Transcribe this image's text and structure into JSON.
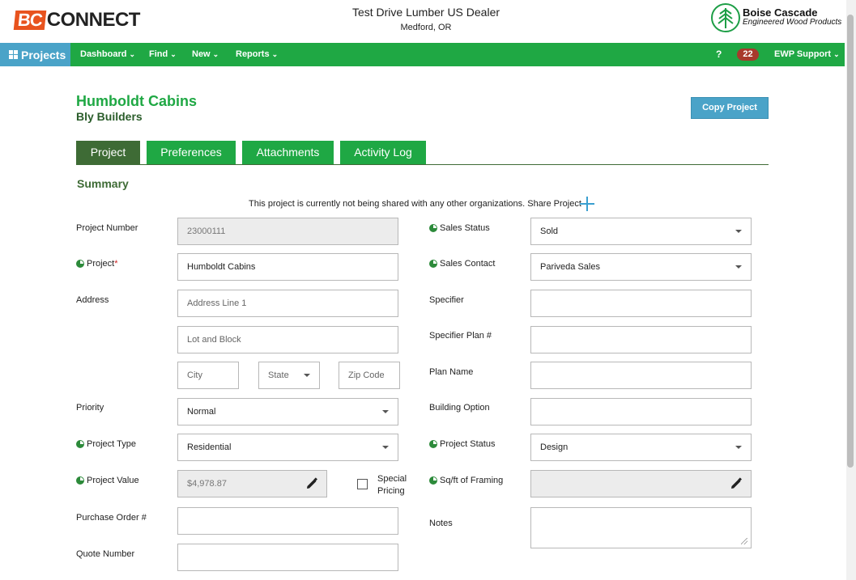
{
  "header": {
    "logo_bc": "BC",
    "logo_connect": "CONNECT",
    "dealer": "Test Drive Lumber US Dealer",
    "city": "Medford, OR",
    "brand_name": "Boise Cascade",
    "brand_sub": "Engineered Wood Products"
  },
  "nav": {
    "projects": "Projects",
    "items": [
      "Dashboard",
      "Find",
      "New",
      "Reports"
    ],
    "help": "?",
    "badge": "22",
    "user": "EWP Support"
  },
  "project": {
    "title": "Humboldt Cabins",
    "client": "Bly Builders",
    "copy_label": "Copy Project"
  },
  "tabs": [
    "Project",
    "Preferences",
    "Attachments",
    "Activity Log"
  ],
  "summary": {
    "heading": "Summary",
    "share_text": "This project is currently not being shared with any other organizations. Share Project"
  },
  "form": {
    "project_number_label": "Project Number",
    "project_number": "23000111",
    "project_label": "Project",
    "project_required": "*",
    "project_value": "Humboldt Cabins",
    "address_label": "Address",
    "address1_ph": "Address Line 1",
    "lot_ph": "Lot and Block",
    "city_ph": "City",
    "state_ph": "State",
    "zip_ph": "Zip Code",
    "priority_label": "Priority",
    "priority": "Normal",
    "project_type_label": "Project Type",
    "project_type": "Residential",
    "project_value_label": "Project Value",
    "project_value_amount": "$4,978.87",
    "special_pricing": "Special Pricing",
    "special_pricing_line1": "Special",
    "special_pricing_line2": "Pricing",
    "po_label": "Purchase Order #",
    "quote_label": "Quote Number",
    "sales_status_label": "Sales Status",
    "sales_status": "Sold",
    "sales_contact_label": "Sales Contact",
    "sales_contact": "Pariveda Sales",
    "specifier_label": "Specifier",
    "specifier_plan_label": "Specifier Plan #",
    "plan_name_label": "Plan Name",
    "building_option_label": "Building Option",
    "project_status_label": "Project Status",
    "project_status": "Design",
    "sqft_label": "Sq/ft of Framing",
    "notes_label": "Notes"
  },
  "colors": {
    "brand_green": "#1fa844",
    "dark_green": "#3e6b35",
    "accent_blue": "#4aa3c8",
    "logo_orange": "#e8531e",
    "badge_red": "#a83a2c"
  }
}
